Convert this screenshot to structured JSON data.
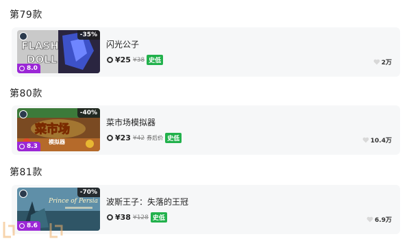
{
  "items": [
    {
      "section_title": "第79款",
      "name": "闪光公子",
      "discount": "-35%",
      "score": "8.0",
      "price": "¥25",
      "original_price": "¥38",
      "price_note": "",
      "badge": "史低",
      "likes": "2万",
      "thumb_text": "FLASH DOLL"
    },
    {
      "section_title": "第80款",
      "name": "菜市场模拟器",
      "discount": "-40%",
      "score": "8.3",
      "price": "¥23",
      "original_price": "¥42",
      "price_note": "券后价",
      "badge": "史低",
      "likes": "10.4万",
      "thumb_text": "菜市场"
    },
    {
      "section_title": "第81款",
      "name": "波斯王子：失落的王冠",
      "discount": "-70%",
      "score": "8.6",
      "price": "¥38",
      "original_price": "¥128",
      "price_note": "",
      "badge": "史低",
      "likes": "6.9万",
      "thumb_text": "Prince of Persia"
    }
  ],
  "colors": {
    "badge_green": "#22b14c",
    "score_purple": "#9b27d6",
    "card_bg": "#f6f7f8"
  }
}
